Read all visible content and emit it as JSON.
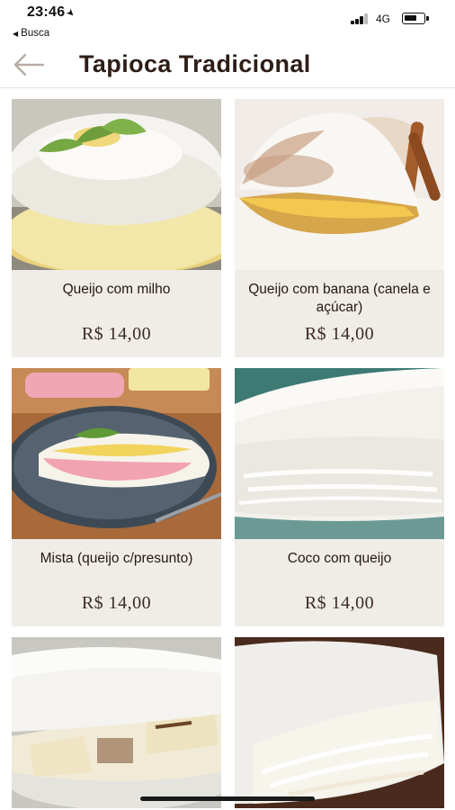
{
  "status_bar": {
    "time": "23:46",
    "back_app": "Busca",
    "network": "4G"
  },
  "header": {
    "title": "Tapioca Tradicional"
  },
  "products": [
    {
      "name": "Queijo com milho",
      "price": "R$ 14,00"
    },
    {
      "name": "Queijo com banana (canela e açúcar)",
      "price": "R$ 14,00"
    },
    {
      "name": "Mista (queijo c/presunto)",
      "price": "R$ 14,00"
    },
    {
      "name": "Coco com queijo",
      "price": "R$ 14,00"
    },
    {
      "name": "",
      "price": ""
    },
    {
      "name": "",
      "price": ""
    }
  ],
  "colors": {
    "card_bg": "#f0ece7",
    "title": "#2e1d17",
    "divider": "#e8e4df"
  }
}
